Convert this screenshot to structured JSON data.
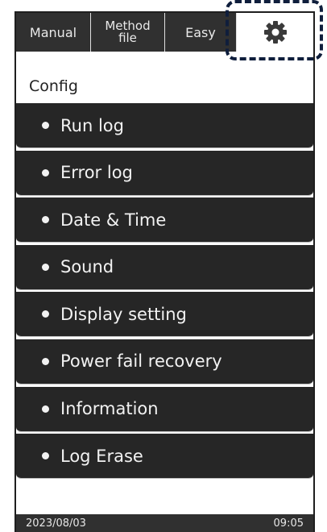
{
  "tabs": {
    "manual": "Manual",
    "method_line1": "Method",
    "method_line2": "file",
    "easy": "Easy",
    "settings_icon": "gear-icon"
  },
  "config": {
    "title": "Config",
    "items": [
      {
        "label": "Run log"
      },
      {
        "label": "Error log"
      },
      {
        "label": "Date & Time"
      },
      {
        "label": "Sound"
      },
      {
        "label": "Display setting"
      },
      {
        "label": "Power fail recovery"
      },
      {
        "label": "Information"
      },
      {
        "label": "Log Erase"
      }
    ]
  },
  "status": {
    "date": "2023/08/03",
    "time": "09:05"
  },
  "colors": {
    "dark": "#262626",
    "highlight": "#0f1e3c"
  }
}
